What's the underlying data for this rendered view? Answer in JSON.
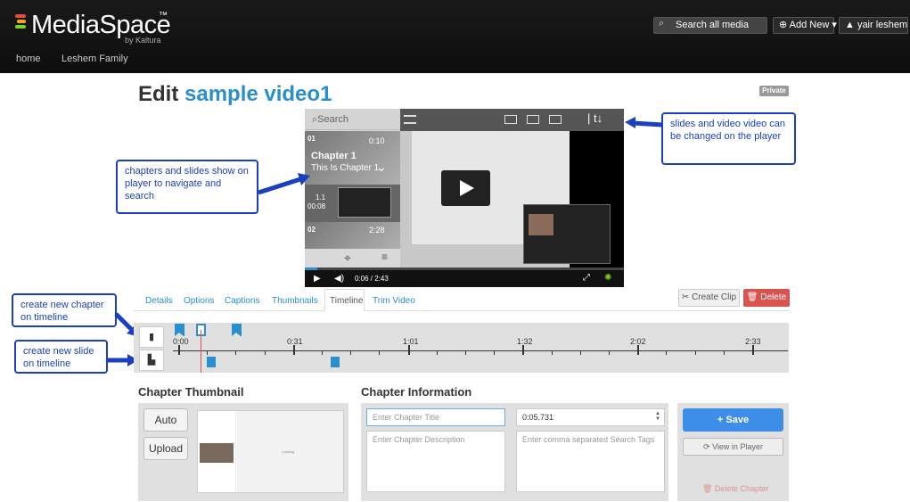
{
  "header": {
    "logo": "MediaSpace",
    "trademark": "™",
    "by_line": "by Kaltura",
    "nav": [
      "home",
      "Leshem Family"
    ],
    "search_placeholder": "Search all media",
    "add_new": "⊕ Add New ▾",
    "user": "▲ yair leshem ▾"
  },
  "page": {
    "title_prefix": "Edit ",
    "title_name": "sample video1",
    "privacy_badge": "Private"
  },
  "player": {
    "search": "Search",
    "chapter1": {
      "index": "01",
      "time": "0:10",
      "title": "Chapter 1",
      "subtitle": "This Is Chapter 1"
    },
    "slide1": {
      "index": "1.1",
      "time": "00:08"
    },
    "chapter2": {
      "index": "02",
      "time": "2:28"
    },
    "time_display": "0:06 / 2:43"
  },
  "annotations": {
    "chapters_slides": "chapters and slides show on player to navigate and search",
    "slides_video": "slides and video video can be changed on the player",
    "new_chapter": "create new chapter on timeline",
    "new_slide": "create new slide on timeline"
  },
  "tabs": [
    "Details",
    "Options",
    "Captions",
    "Thumbnails",
    "Timeline",
    "Trim Video"
  ],
  "actions": {
    "create_clip": "✂ Create Clip",
    "delete": "🗑 Delete"
  },
  "timeline": {
    "labels": [
      "0:00",
      "0:31",
      "1:01",
      "1:32",
      "2:02",
      "2:33"
    ]
  },
  "thumbnail_panel": {
    "heading": "Chapter Thumbnail",
    "auto": "Auto",
    "upload": "Upload",
    "loading": "Loading"
  },
  "info_panel": {
    "heading": "Chapter Information",
    "title_placeholder": "Enter Chapter Title",
    "time_value": "0:05.731",
    "description_placeholder": "Enter Chapter Description",
    "tags_placeholder": "Enter comma separated Search Tags"
  },
  "save_panel": {
    "save": "+ Save",
    "view_in_player": "⟳ View in Player",
    "delete_chapter": "🗑 Delete Chapter"
  },
  "colors": {
    "accent": "#2a8fce",
    "annotation": "#1a3fc0",
    "danger": "#d9534f",
    "save": "#3d8ee8"
  }
}
